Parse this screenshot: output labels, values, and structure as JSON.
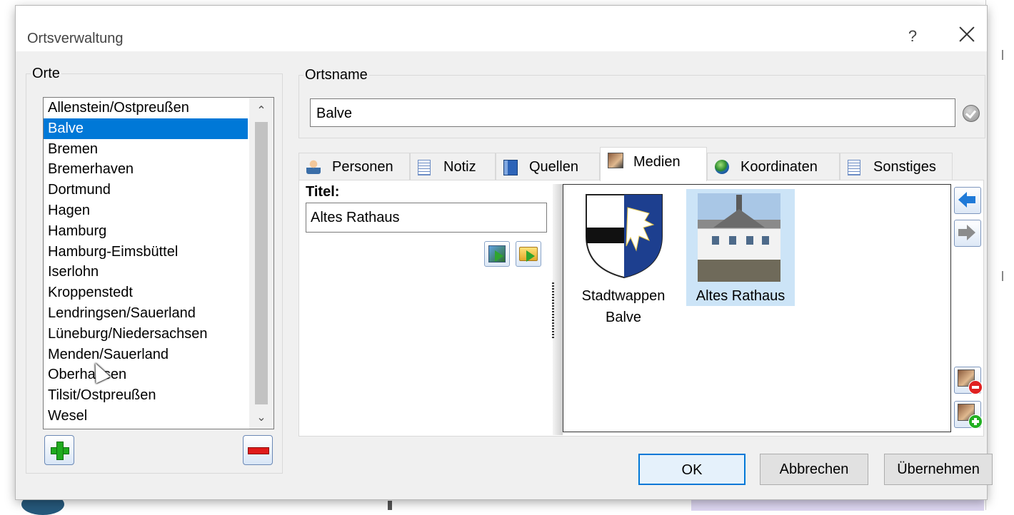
{
  "dialog": {
    "title": "Ortsverwaltung",
    "help_label": "?"
  },
  "places": {
    "legend": "Orte",
    "items": [
      "Allenstein/Ostpreußen",
      "Balve",
      "Bremen",
      "Bremerhaven",
      "Dortmund",
      "Hagen",
      "Hamburg",
      "Hamburg-Eimsbüttel",
      "Iserlohn",
      "Kroppenstedt",
      "Lendringsen/Sauerland",
      "Lüneburg/Niedersachsen",
      "Menden/Sauerland",
      "Oberhausen",
      "Tilsit/Ostpreußen",
      "Wesel"
    ],
    "selected": "Balve"
  },
  "place_name": {
    "legend": "Ortsname",
    "value": "Balve"
  },
  "tabs": [
    {
      "label": "Personen",
      "icon": "person-icon"
    },
    {
      "label": "Notiz",
      "icon": "note-icon"
    },
    {
      "label": "Quellen",
      "icon": "book-icon"
    },
    {
      "label": "Medien",
      "icon": "media-icon",
      "active": true
    },
    {
      "label": "Koordinaten",
      "icon": "globe-icon"
    },
    {
      "label": "Sonstiges",
      "icon": "document-icon"
    }
  ],
  "media_tab": {
    "title_label": "Titel:",
    "title_value": "Altes Rathaus",
    "items": [
      {
        "caption_line1": "Stadtwappen",
        "caption_line2": "Balve",
        "selected": false
      },
      {
        "caption_line1": "Altes Rathaus",
        "caption_line2": "",
        "selected": true
      }
    ]
  },
  "buttons": {
    "ok": "OK",
    "cancel": "Abbrechen",
    "apply": "Übernehmen"
  },
  "colors": {
    "selection": "#0078d7",
    "thumb_selection": "#cce4f7"
  }
}
